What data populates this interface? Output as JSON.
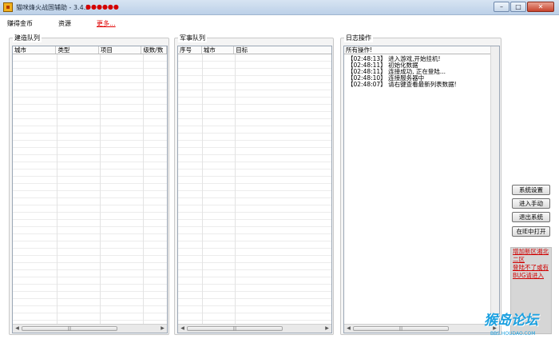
{
  "window": {
    "title": "猫咪烽火战国辅助 - 3.4.3 -",
    "title_suffix": "●●●●●●",
    "minimize": "–",
    "maximize": "□",
    "close": "✕"
  },
  "menu": {
    "gold": "赚得金币",
    "resources": "资源",
    "more": "更多..."
  },
  "build_queue": {
    "title": "建造队列",
    "columns": [
      "城市",
      "类型",
      "项目",
      "级数/数"
    ],
    "scroll_thumb": "|||"
  },
  "military_queue": {
    "title": "军事队列",
    "columns": [
      "序号",
      "城市",
      "目标"
    ],
    "scroll_thumb": "|||"
  },
  "log": {
    "title": "日志操作",
    "header": "所有操作!",
    "lines": [
      "【02:48:13】 进入游戏,开始挂机!",
      "【02:48:11】 初始化数据",
      "【02:48:11】 连接成功, 正在登陆...",
      "【02:48:10】 连接服务器中",
      "【02:48:07】 请右键查看最新列表数据!"
    ],
    "scroll_thumb": "|||"
  },
  "buttons": {
    "settings": "系统设置",
    "manual": "进入手动",
    "exit": "退出系统",
    "open_ie": "在IE中打开"
  },
  "notice": {
    "line1": "增加新区湘北",
    "line2": "二区",
    "line3": "登陆不了或有",
    "line4": "BUG请进入"
  },
  "watermark": {
    "text": "猴岛论坛",
    "url": "BBS.HOUDAO.COM"
  },
  "colors": {
    "accent_red": "#e00000",
    "watermark_blue": "#1aa0e0"
  }
}
